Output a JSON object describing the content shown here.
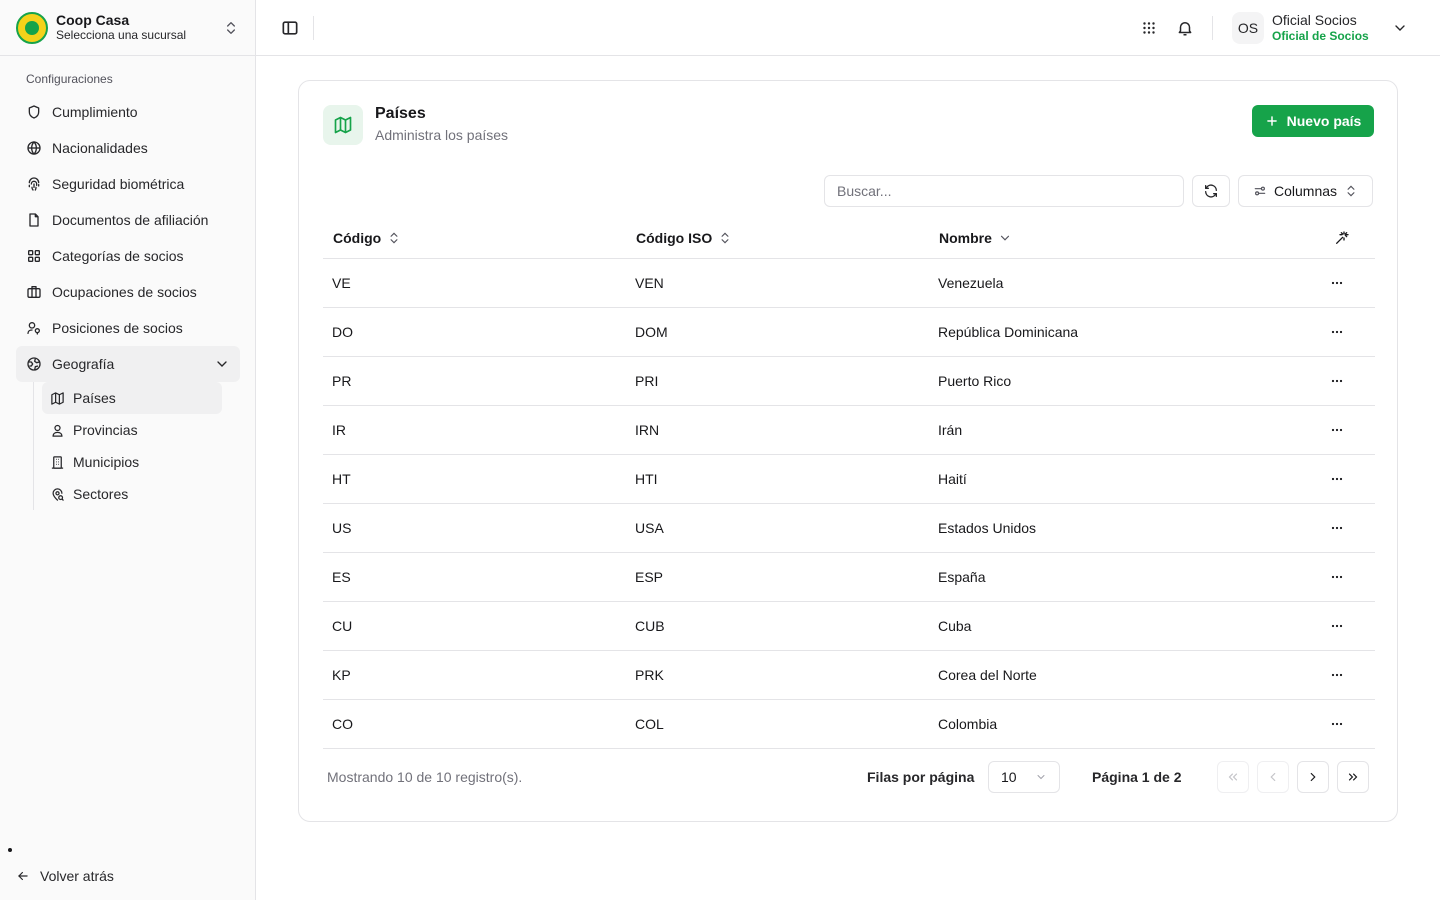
{
  "brand": {
    "title": "Coop Casa",
    "subtitle": "Selecciona una sucursal"
  },
  "sidebar": {
    "section_label": "Configuraciones",
    "items": [
      {
        "label": "Cumplimiento",
        "icon": "shield-icon"
      },
      {
        "label": "Nacionalidades",
        "icon": "globe-icon"
      },
      {
        "label": "Seguridad biométrica",
        "icon": "fingerprint-icon"
      },
      {
        "label": "Documentos de afiliación",
        "icon": "file-icon"
      },
      {
        "label": "Categorías de socios",
        "icon": "grid-icon"
      },
      {
        "label": "Ocupaciones de socios",
        "icon": "briefcase-icon"
      },
      {
        "label": "Posiciones de socios",
        "icon": "users-icon"
      },
      {
        "label": "Geografía",
        "icon": "earth-icon",
        "expanded": true
      }
    ],
    "subitems": [
      {
        "label": "Países",
        "icon": "map-icon",
        "active": true
      },
      {
        "label": "Provincias",
        "icon": "map-pin-user-icon"
      },
      {
        "label": "Municipios",
        "icon": "building-icon"
      },
      {
        "label": "Sectores",
        "icon": "map-pin-search-icon"
      }
    ],
    "back_label": "Volver atrás"
  },
  "topbar": {
    "user_initials": "OS",
    "user_name": "Oficial Socios",
    "user_role": "Oficial de Socios"
  },
  "page": {
    "title": "Países",
    "subtitle": "Administra los países",
    "new_button": "Nuevo país",
    "search_placeholder": "Buscar...",
    "columns_button": "Columnas"
  },
  "table": {
    "headers": {
      "code": "Código",
      "iso": "Código ISO",
      "name": "Nombre"
    },
    "rows": [
      {
        "code": "VE",
        "iso": "VEN",
        "name": "Venezuela"
      },
      {
        "code": "DO",
        "iso": "DOM",
        "name": "República Dominicana"
      },
      {
        "code": "PR",
        "iso": "PRI",
        "name": "Puerto Rico"
      },
      {
        "code": "IR",
        "iso": "IRN",
        "name": "Irán"
      },
      {
        "code": "HT",
        "iso": "HTI",
        "name": "Haití"
      },
      {
        "code": "US",
        "iso": "USA",
        "name": "Estados Unidos"
      },
      {
        "code": "ES",
        "iso": "ESP",
        "name": "España"
      },
      {
        "code": "CU",
        "iso": "CUB",
        "name": "Cuba"
      },
      {
        "code": "KP",
        "iso": "PRK",
        "name": "Corea del Norte"
      },
      {
        "code": "CO",
        "iso": "COL",
        "name": "Colombia"
      }
    ]
  },
  "footer": {
    "count_text": "Mostrando 10 de 10 registro(s).",
    "rows_per_page_label": "Filas por página",
    "rows_per_page_value": "10",
    "page_text": "Página 1 de 2"
  },
  "colors": {
    "accent": "#16a34a",
    "accent_soft": "#e8f5ec",
    "border": "#e4e4e7"
  }
}
